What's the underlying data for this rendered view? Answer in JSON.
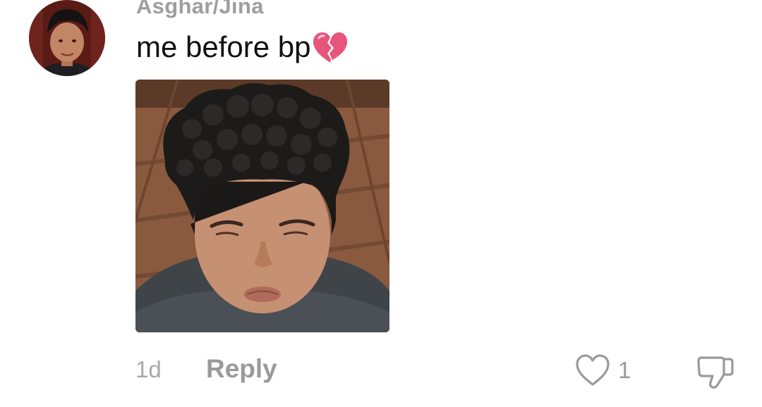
{
  "comment": {
    "username": "Asghar/Jina",
    "text": "me before bp",
    "text_emoji": "broken-heart",
    "timestamp": "1d",
    "reply_label": "Reply",
    "like_count": "1",
    "icons": {
      "like": "heart-outline-icon",
      "dislike": "thumbs-down-outline-icon"
    },
    "colors": {
      "username": "#9e9e9e",
      "meta": "#9a9a9a",
      "emoji": "#e8557a"
    }
  }
}
